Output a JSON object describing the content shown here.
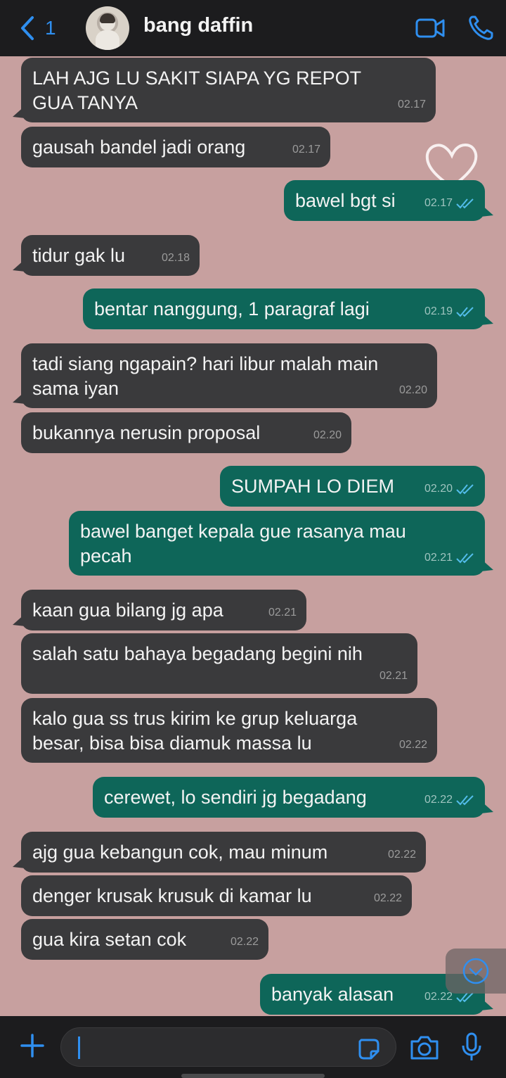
{
  "header": {
    "back_count": "1",
    "contact_name": "bang daffin"
  },
  "messages": [
    {
      "dir": "in",
      "text": "LAH AJG LU SAKIT SIAPA YG REPOT\nGUA TANYA",
      "time": "02.17"
    },
    {
      "dir": "in",
      "text": "gausah bandel jadi orang",
      "time": "02.17"
    },
    {
      "dir": "out",
      "text": "bawel bgt si",
      "time": "02.17"
    },
    {
      "dir": "in",
      "text": "tidur gak lu",
      "time": "02.18"
    },
    {
      "dir": "out",
      "text": "bentar nanggung, 1 paragraf lagi",
      "time": "02.19"
    },
    {
      "dir": "in",
      "text": "tadi siang ngapain? hari libur malah main\nsama iyan",
      "time": "02.20"
    },
    {
      "dir": "in",
      "text": "bukannya nerusin proposal",
      "time": "02.20"
    },
    {
      "dir": "out",
      "text": "SUMPAH LO DIEM",
      "time": "02.20"
    },
    {
      "dir": "out",
      "text": "bawel banget kepala gue rasanya mau\npecah",
      "time": "02.21"
    },
    {
      "dir": "in",
      "text": "kaan gua bilang jg apa",
      "time": "02.21"
    },
    {
      "dir": "in",
      "text": "salah satu bahaya begadang begini nih",
      "time": "02.21"
    },
    {
      "dir": "in",
      "text": "kalo gua ss trus kirim ke grup keluarga\nbesar, bisa bisa diamuk massa lu",
      "time": "02.22"
    },
    {
      "dir": "out",
      "text": "cerewet, lo sendiri jg begadang",
      "time": "02.22"
    },
    {
      "dir": "in",
      "text": "ajg gua kebangun cok, mau minum",
      "time": "02.22"
    },
    {
      "dir": "in",
      "text": "denger krusak krusuk di kamar lu",
      "time": "02.22"
    },
    {
      "dir": "in",
      "text": "gua kira setan cok",
      "time": "02.22"
    },
    {
      "dir": "out",
      "text": "banyak alasan",
      "time": "02.22"
    }
  ],
  "colors": {
    "accent": "#2f8ff0",
    "incoming_bubble": "#3a3a3c",
    "outgoing_bubble": "#0e6659",
    "chat_background": "#c7a09f",
    "read_ticks": "#53bdeb"
  },
  "icons": [
    "back-chevron-icon",
    "video-call-icon",
    "phone-icon",
    "plus-icon",
    "sticker-icon",
    "camera-icon",
    "microphone-icon",
    "scroll-down-icon",
    "read-ticks-icon"
  ]
}
